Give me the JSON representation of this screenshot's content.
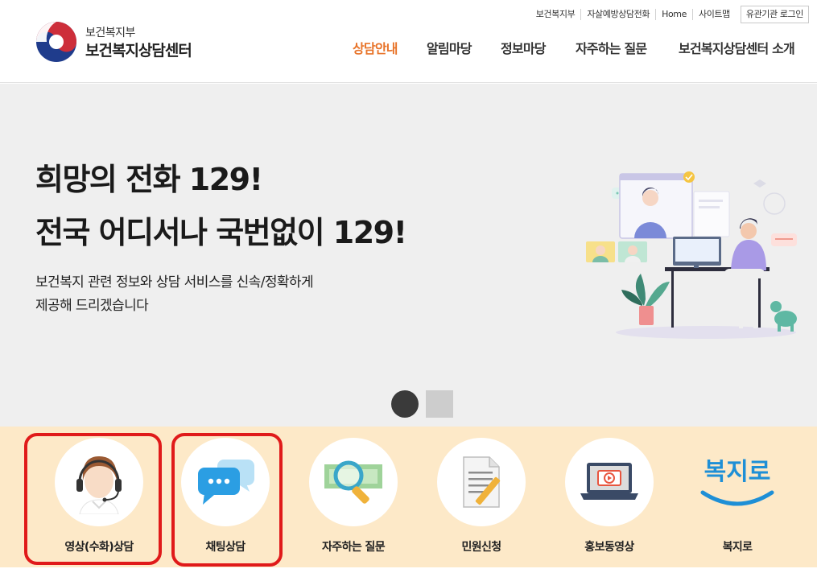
{
  "header": {
    "org_name": "보건복지부",
    "site_name": "보건복지상담센터",
    "utility_links": [
      "보건복지부",
      "자살예방상담전화",
      "Home",
      "사이트맵"
    ],
    "login_button": "유관기관 로그인",
    "nav": [
      {
        "label": "상담안내",
        "active": true
      },
      {
        "label": "알림마당",
        "active": false
      },
      {
        "label": "정보마당",
        "active": false
      },
      {
        "label": "자주하는 질문",
        "active": false
      },
      {
        "label": "보건복지상담센터 소개",
        "active": false
      }
    ]
  },
  "hero": {
    "title_line1": "희망의 전화 129!",
    "title_line2": "전국 어디서나 국번없이 129!",
    "subtitle_line1": "보건복지 관련 정보와 상담 서비스를 신속/정확하게",
    "subtitle_line2": "제공해 드리겠습니다",
    "slides": 2,
    "active_slide": 1
  },
  "quick_menu": [
    {
      "label": "영상(수화)상담",
      "icon": "counselor-headset-icon",
      "highlighted": true
    },
    {
      "label": "채팅상담",
      "icon": "chat-bubbles-icon",
      "highlighted": true
    },
    {
      "label": "자주하는 질문",
      "icon": "magnifier-icon",
      "highlighted": false
    },
    {
      "label": "민원신청",
      "icon": "document-pencil-icon",
      "highlighted": false
    },
    {
      "label": "홍보동영상",
      "icon": "laptop-video-icon",
      "highlighted": false
    },
    {
      "label": "복지로",
      "icon": "bokjiro-logo",
      "logo_text": "복지로",
      "highlighted": false
    }
  ],
  "colors": {
    "nav_active": "#e8742a",
    "quick_bg": "#fde9c8",
    "hero_bg": "#efefef",
    "highlight_border": "#e01a1a"
  }
}
